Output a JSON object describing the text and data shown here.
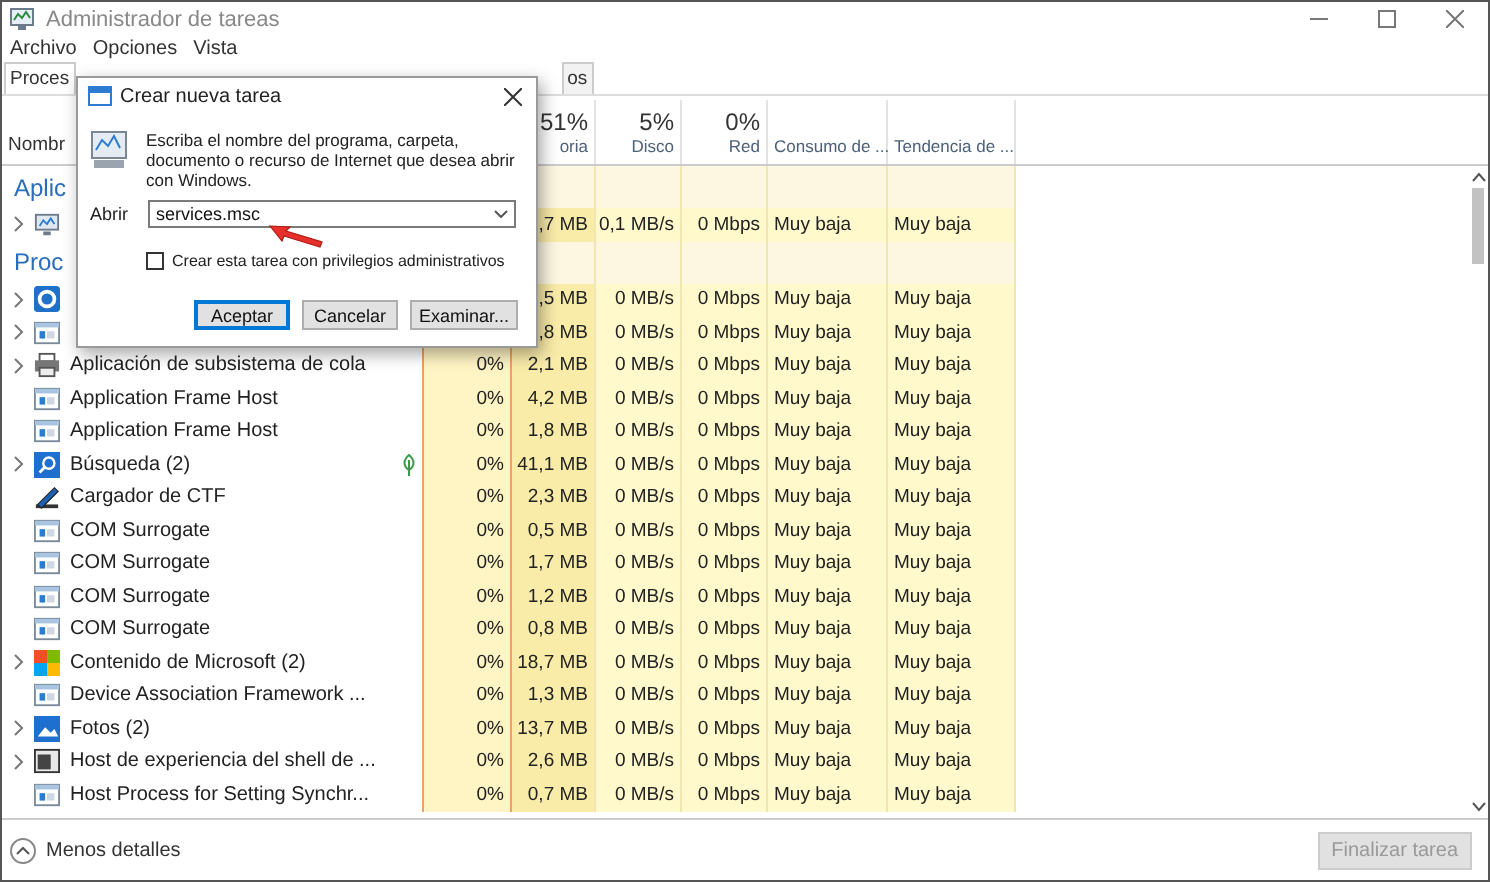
{
  "window": {
    "title": "Administrador de tareas"
  },
  "menu": [
    "Archivo",
    "Opciones",
    "Vista"
  ],
  "tabs": [
    {
      "label": "Proces",
      "selected": true
    },
    {
      "label": "os",
      "selected": false
    }
  ],
  "table": {
    "columns": [
      {
        "label": "Nombr"
      },
      {},
      {
        "percent": "51%",
        "label": "oria"
      },
      {
        "percent": "5%",
        "label": "Disco"
      },
      {
        "percent": "0%",
        "label": "Red"
      },
      {
        "label": "Consumo de ..."
      },
      {
        "label": "Tendencia de ..."
      }
    ],
    "rows": [
      {
        "kind": "group",
        "name": "Aplic"
      },
      {
        "kind": "monitor",
        "expandable": true,
        "suspended": false,
        "mem": ",7 MB",
        "disk": "0,1 MB/s",
        "net": "0 Mbps",
        "power": "Muy baja",
        "trend": "Muy baja"
      },
      {
        "kind": "group",
        "name": "Proc"
      },
      {
        "kind": "gear",
        "expandable": true,
        "suspended": false,
        "mem": ",5 MB",
        "disk": "0 MB/s",
        "net": "0 Mbps",
        "power": "Muy baja",
        "trend": "Muy baja"
      },
      {
        "kind": "window",
        "expandable": true,
        "suspended": false,
        "mem": ",8 MB",
        "disk": "0 MB/s",
        "net": "0 Mbps",
        "power": "Muy baja",
        "trend": "Muy baja"
      },
      {
        "kind": "printer",
        "expandable": true,
        "suspended": false,
        "name": "Aplicación de subsistema de cola",
        "cpu": "0%",
        "mem": "2,1 MB",
        "disk": "0 MB/s",
        "net": "0 Mbps",
        "power": "Muy baja",
        "trend": "Muy baja"
      },
      {
        "kind": "window",
        "expandable": false,
        "suspended": false,
        "name": "Application Frame Host",
        "cpu": "0%",
        "mem": "4,2 MB",
        "disk": "0 MB/s",
        "net": "0 Mbps",
        "power": "Muy baja",
        "trend": "Muy baja"
      },
      {
        "kind": "window",
        "expandable": false,
        "suspended": false,
        "name": "Application Frame Host",
        "cpu": "0%",
        "mem": "1,8 MB",
        "disk": "0 MB/s",
        "net": "0 Mbps",
        "power": "Muy baja",
        "trend": "Muy baja"
      },
      {
        "kind": "search",
        "expandable": true,
        "suspended": true,
        "name": "Búsqueda (2)",
        "cpu": "0%",
        "mem": "41,1 MB",
        "disk": "0 MB/s",
        "net": "0 Mbps",
        "power": "Muy baja",
        "trend": "Muy baja"
      },
      {
        "kind": "pen",
        "expandable": false,
        "suspended": false,
        "name": "Cargador de CTF",
        "cpu": "0%",
        "mem": "2,3 MB",
        "disk": "0 MB/s",
        "net": "0 Mbps",
        "power": "Muy baja",
        "trend": "Muy baja"
      },
      {
        "kind": "window",
        "expandable": false,
        "suspended": false,
        "name": "COM Surrogate",
        "cpu": "0%",
        "mem": "0,5 MB",
        "disk": "0 MB/s",
        "net": "0 Mbps",
        "power": "Muy baja",
        "trend": "Muy baja"
      },
      {
        "kind": "window",
        "expandable": false,
        "suspended": false,
        "name": "COM Surrogate",
        "cpu": "0%",
        "mem": "1,7 MB",
        "disk": "0 MB/s",
        "net": "0 Mbps",
        "power": "Muy baja",
        "trend": "Muy baja"
      },
      {
        "kind": "window",
        "expandable": false,
        "suspended": false,
        "name": "COM Surrogate",
        "cpu": "0%",
        "mem": "1,2 MB",
        "disk": "0 MB/s",
        "net": "0 Mbps",
        "power": "Muy baja",
        "trend": "Muy baja"
      },
      {
        "kind": "window",
        "expandable": false,
        "suspended": false,
        "name": "COM Surrogate",
        "cpu": "0%",
        "mem": "0,8 MB",
        "disk": "0 MB/s",
        "net": "0 Mbps",
        "power": "Muy baja",
        "trend": "Muy baja"
      },
      {
        "kind": "tiles",
        "expandable": true,
        "suspended": false,
        "name": "Contenido de Microsoft (2)",
        "cpu": "0%",
        "mem": "18,7 MB",
        "disk": "0 MB/s",
        "net": "0 Mbps",
        "power": "Muy baja",
        "trend": "Muy baja"
      },
      {
        "kind": "window",
        "expandable": false,
        "suspended": false,
        "name": "Device Association Framework ...",
        "cpu": "0%",
        "mem": "1,3 MB",
        "disk": "0 MB/s",
        "net": "0 Mbps",
        "power": "Muy baja",
        "trend": "Muy baja"
      },
      {
        "kind": "photos",
        "expandable": true,
        "suspended": false,
        "name": "Fotos (2)",
        "cpu": "0%",
        "mem": "13,7 MB",
        "disk": "0 MB/s",
        "net": "0 Mbps",
        "power": "Muy baja",
        "trend": "Muy baja"
      },
      {
        "kind": "shell",
        "expandable": true,
        "suspended": false,
        "name": "Host de experiencia del shell de ...",
        "cpu": "0%",
        "mem": "2,6 MB",
        "disk": "0 MB/s",
        "net": "0 Mbps",
        "power": "Muy baja",
        "trend": "Muy baja"
      },
      {
        "kind": "window",
        "expandable": false,
        "suspended": false,
        "name": "Host Process for Setting Synchr...",
        "cpu": "0%",
        "mem": "0,7 MB",
        "disk": "0 MB/s",
        "net": "0 Mbps",
        "power": "Muy baja",
        "trend": "Muy baja"
      }
    ]
  },
  "footer": {
    "toggle": "Menos detalles",
    "end_button": {
      "label": "Finalizar tarea",
      "disabled": true
    }
  },
  "dialog": {
    "title": "Crear nueva tarea",
    "message": "Escriba el nombre del programa, carpeta, documento o recurso de Internet que desea abrir con Windows.",
    "open_label": "Abrir",
    "open_value": "services.msc",
    "admin_checkbox": {
      "label": "Crear esta tarea con privilegios administrativos",
      "checked": false
    },
    "buttons": [
      {
        "label": "Aceptar",
        "default": true
      },
      {
        "label": "Cancelar",
        "default": false
      },
      {
        "label": "Examinar...",
        "default": false
      }
    ]
  }
}
